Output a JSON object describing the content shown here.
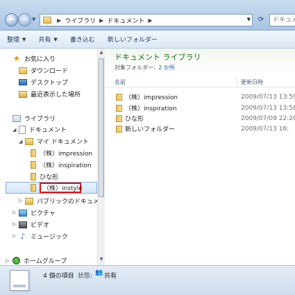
{
  "address": {
    "segments": [
      "ライブラリ",
      "ドキュメント"
    ],
    "search_placeholder": "ドキュメ"
  },
  "toolbar": {
    "organize": "整理",
    "share": "共有",
    "burn": "書き込む",
    "new_folder": "新しいフォルダー"
  },
  "nav": {
    "favorites": "お気に入り",
    "downloads": "ダウンロード",
    "desktop": "デスクトップ",
    "recent": "最近表示した場所",
    "libraries": "ライブラリ",
    "documents": "ドキュメント",
    "my_documents": "マイ ドキュメント",
    "sub_impression": "（株）impression",
    "sub_inspiration": "（株）inspiration",
    "sub_hinagata": "ひな形",
    "sub_instyle": "（株）instyle",
    "public_documents": "パブリックのドキュメント",
    "pictures": "ピクチャ",
    "videos": "ビデオ",
    "music": "ミュージック",
    "homegroup": "ホームグループ"
  },
  "content": {
    "title": "ドキュメント ライブラリ",
    "subtitle_label": "対象フォルダー:",
    "subtitle_link": "2 か所",
    "col_name": "名前",
    "col_date": "更新日時",
    "files": [
      {
        "name": "（株）impression",
        "date": "2009/07/13 13:59"
      },
      {
        "name": "（株）inspiration",
        "date": "2009/07/13 13:58"
      },
      {
        "name": "ひな形",
        "date": "2009/07/09 22:20"
      },
      {
        "name": "新しいフォルダー",
        "date": "2009/07/13 16:"
      }
    ]
  },
  "status": {
    "count": "4 個の項目",
    "state_label": "状態:",
    "state_value": "共有"
  }
}
